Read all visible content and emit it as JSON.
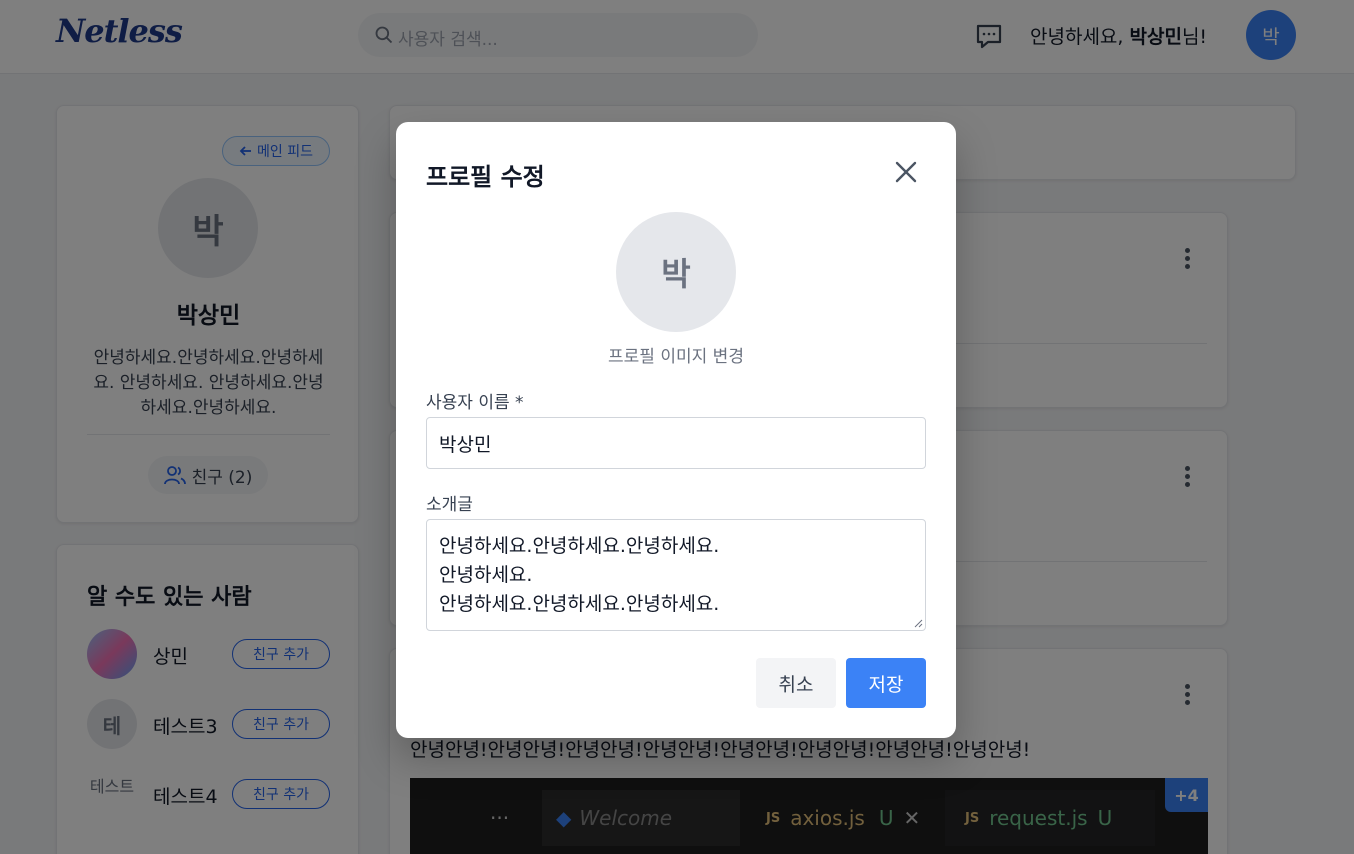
{
  "header": {
    "logo": "Netless",
    "search_placeholder": "사용자 검색...",
    "greeting_prefix": "안녕하세요, ",
    "greeting_name": "박상민",
    "greeting_suffix": "님!",
    "avatar_initial": "박"
  },
  "profile": {
    "back_label": "메인 피드",
    "avatar_initial": "박",
    "name": "박상민",
    "bio": "안녕하세요.안녕하세요.안녕하세요. 안녕하세요. 안녕하세요.안녕하세요.안녕하세요.",
    "friends_label": "친구 (2)"
  },
  "suggestions": {
    "title": "알 수도 있는 사람",
    "add_label": "친구 추가",
    "items": [
      {
        "name": "상민",
        "initial": ""
      },
      {
        "name": "테스트3",
        "initial": "테"
      },
      {
        "name": "테스트4",
        "initial": "테스트"
      }
    ]
  },
  "feed": {
    "post_text": "안녕안녕!안녕안녕!안녕안녕!안녕안녕!안녕안녕!안녕안녕!안녕안녕!안녕안녕!",
    "image_tabs": [
      "Welcome",
      "axios.js",
      "U",
      "request.js",
      "U"
    ],
    "extra_images": "+4"
  },
  "modal": {
    "title": "프로필 수정",
    "avatar_initial": "박",
    "change_image_label": "프로필 이미지 변경",
    "username_label": "사용자 이름 *",
    "username_value": "박상민",
    "bio_label": "소개글",
    "bio_value": "안녕하세요.안녕하세요.안녕하세요.\n안녕하세요.\n안녕하세요.안녕하세요.안녕하세요.",
    "cancel_label": "취소",
    "save_label": "저장"
  },
  "colors": {
    "primary": "#3b82f6",
    "logo": "#1e3a8a",
    "overlay": "rgba(0,0,0,0.5)"
  }
}
